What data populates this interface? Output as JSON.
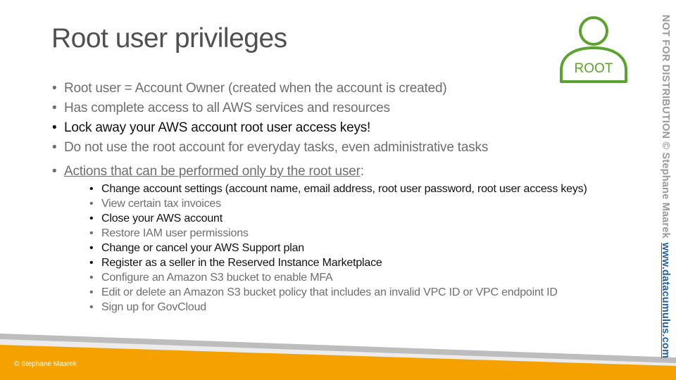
{
  "title": "Root user privileges",
  "root_icon": {
    "label": "ROOT",
    "color": "#5aa32e",
    "icon": "user-icon"
  },
  "bullets": [
    {
      "text": "Root user = Account Owner (created when the account is created)",
      "bold": false
    },
    {
      "text": "Has complete access to all AWS services and resources",
      "bold": false
    },
    {
      "text": "Lock away your AWS account root user access keys!",
      "bold": true
    },
    {
      "text": "Do not use the root account for everyday tasks, even administrative tasks",
      "bold": false
    }
  ],
  "actions_header": {
    "underlined": "Actions that can be performed only by the root user",
    "suffix": ":"
  },
  "actions": [
    {
      "bold": "Change account settings",
      "rest": " (account name, email address, root user password, root user access keys)"
    },
    {
      "bold": "",
      "rest": "View certain tax invoices"
    },
    {
      "bold": "Close your AWS account",
      "rest": ""
    },
    {
      "bold": "",
      "rest": "Restore IAM user permissions"
    },
    {
      "bold": "Change or cancel your AWS Support plan",
      "rest": ""
    },
    {
      "bold": "Register as a seller in the Reserved Instance Marketplace",
      "rest": ""
    },
    {
      "bold": "",
      "rest": "Configure an Amazon S3 bucket to enable MFA"
    },
    {
      "bold": "",
      "rest": "Edit or delete an Amazon S3 bucket policy that includes an invalid VPC ID or VPC endpoint ID"
    },
    {
      "bold": "",
      "rest": "Sign up for GovCloud"
    }
  ],
  "footer": {
    "copyright": "© Stephane Maarek",
    "band_color": "#f5a100",
    "stripe_color": "#bdbdbd"
  },
  "side_text": {
    "notice": "NOT FOR DISTRIBUTION © Stephane Maarek",
    "url": "www.datacumulus.com"
  }
}
